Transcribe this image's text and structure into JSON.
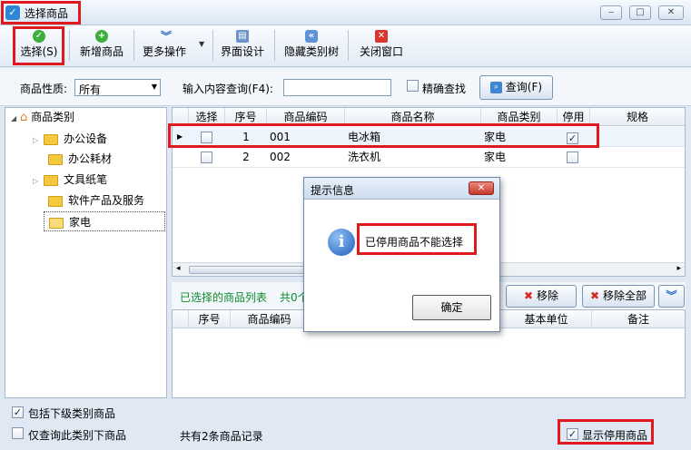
{
  "window": {
    "title": "选择商品",
    "controls": [
      "‒",
      "□",
      "✕"
    ]
  },
  "toolbar": {
    "select": "选择(S)",
    "add": "新增商品",
    "more": "更多操作",
    "design": "界面设计",
    "hide_tree": "隐藏类别树",
    "close": "关闭窗口"
  },
  "filter": {
    "nature_label": "商品性质:",
    "nature_value": "所有",
    "query_label": "输入内容查询(F4):",
    "query_value": "",
    "exact_label": "精确查找",
    "query_button": "查询(F)"
  },
  "tree": {
    "root": "商品类别",
    "items": [
      "办公设备",
      "办公耗材",
      "文具纸笔",
      "软件产品及服务",
      "家电"
    ]
  },
  "product_grid": {
    "columns": [
      "选择",
      "序号",
      "商品编码",
      "商品名称",
      "商品类别",
      "停用",
      "规格"
    ],
    "rows": [
      {
        "selected": false,
        "no": "1",
        "code": "001",
        "name": "电冰箱",
        "category": "家电",
        "disabled": true
      },
      {
        "selected": false,
        "no": "2",
        "code": "002",
        "name": "洗衣机",
        "category": "家电",
        "disabled": false
      }
    ]
  },
  "selected_panel": {
    "title": "已选择的商品列表",
    "count_text": "共0个",
    "remove": "移除",
    "remove_all": "移除全部",
    "columns": [
      "序号",
      "商品编码",
      "基本单位",
      "备注"
    ]
  },
  "options": {
    "include_sub": "包括下级类别商品",
    "only_this": "仅查询此类别下商品"
  },
  "status": {
    "total": "共有2条商品记录",
    "show_disabled": "显示停用商品"
  },
  "dialog": {
    "title": "提示信息",
    "message": "已停用商品不能选择",
    "ok": "确定"
  },
  "colors": {
    "highlight_red": "#e0191f",
    "accent_blue": "#2f86d6"
  }
}
